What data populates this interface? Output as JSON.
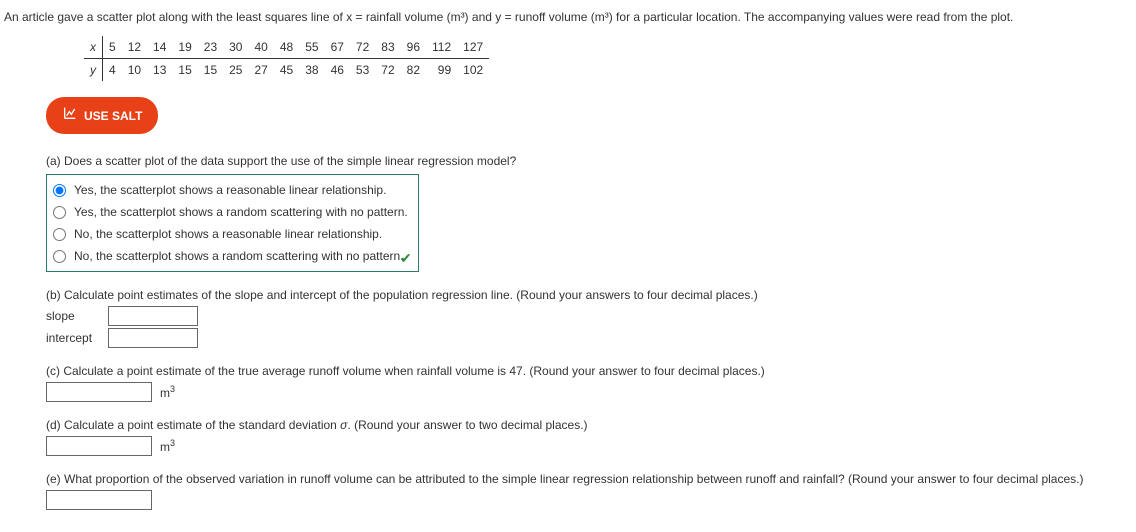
{
  "intro": "An article gave a scatter plot along with the least squares line of x = rainfall volume (m³) and y = runoff volume (m³) for a particular location. The accompanying values were read from the plot.",
  "table": {
    "x_label": "x",
    "y_label": "y",
    "x": [
      "5",
      "12",
      "14",
      "19",
      "23",
      "30",
      "40",
      "48",
      "55",
      "67",
      "72",
      "83",
      "96",
      "112",
      "127"
    ],
    "y": [
      "4",
      "10",
      "13",
      "15",
      "15",
      "25",
      "27",
      "45",
      "38",
      "46",
      "53",
      "72",
      "82",
      "99",
      "102"
    ]
  },
  "salt_button": "USE SALT",
  "parts": {
    "a": {
      "prompt": "(a) Does a scatter plot of the data support the use of the simple linear regression model?",
      "options": [
        "Yes, the scatterplot shows a reasonable linear relationship.",
        "Yes, the scatterplot shows a random scattering with no pattern.",
        "No, the scatterplot shows a reasonable linear relationship.",
        "No, the scatterplot shows a random scattering with no pattern."
      ],
      "selected": 0
    },
    "b": {
      "prompt": "(b) Calculate point estimates of the slope and intercept of the population regression line. (Round your answers to four decimal places.)",
      "slope_label": "slope",
      "intercept_label": "intercept"
    },
    "c": {
      "prompt": "(c) Calculate a point estimate of the true average runoff volume when rainfall volume is 47. (Round your answer to four decimal places.)",
      "unit": "m",
      "exp": "3"
    },
    "d": {
      "prompt_pre": "(d) Calculate a point estimate of the standard deviation ",
      "sigma": "σ",
      "prompt_post": ". (Round your answer to two decimal places.)",
      "unit": "m",
      "exp": "3"
    },
    "e": {
      "prompt": "(e) What proportion of the observed variation in runoff volume can be attributed to the simple linear regression relationship between runoff and rainfall? (Round your answer to four decimal places.)"
    }
  }
}
